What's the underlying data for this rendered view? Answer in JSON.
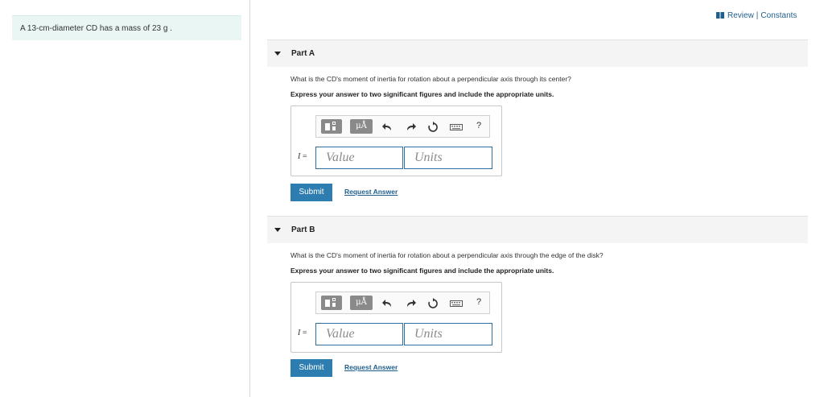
{
  "problem": {
    "text": "A 13-cm-diameter CD has a mass of 23 g ."
  },
  "topbar": {
    "review_label": "Review",
    "separator": "|",
    "constants_label": "Constants",
    "icon": "book-icon",
    "color": "#1f5f8b"
  },
  "parts": [
    {
      "title": "Part A",
      "question": "What is the CD's moment of inertia for rotation about a perpendicular axis through its center?",
      "instruction": "Express your answer to two significant figures and include the appropriate units.",
      "variable": "I",
      "equals": "=",
      "value_placeholder": "Value",
      "units_placeholder": "Units",
      "symbols_label": "μÅ",
      "help_label": "?",
      "submit_label": "Submit",
      "request_label": "Request Answer"
    },
    {
      "title": "Part B",
      "question": "What is the CD's moment of inertia for rotation about a perpendicular axis through the edge of the disk?",
      "instruction": "Express your answer to two significant figures and include the appropriate units.",
      "variable": "I",
      "equals": "=",
      "value_placeholder": "Value",
      "units_placeholder": "Units",
      "symbols_label": "μÅ",
      "help_label": "?",
      "submit_label": "Submit",
      "request_label": "Request Answer"
    }
  ],
  "colors": {
    "accent": "#2e7db0",
    "link": "#1f5f8b",
    "problem_bg": "#e9f6f4",
    "input_border": "#2d6fa3"
  }
}
